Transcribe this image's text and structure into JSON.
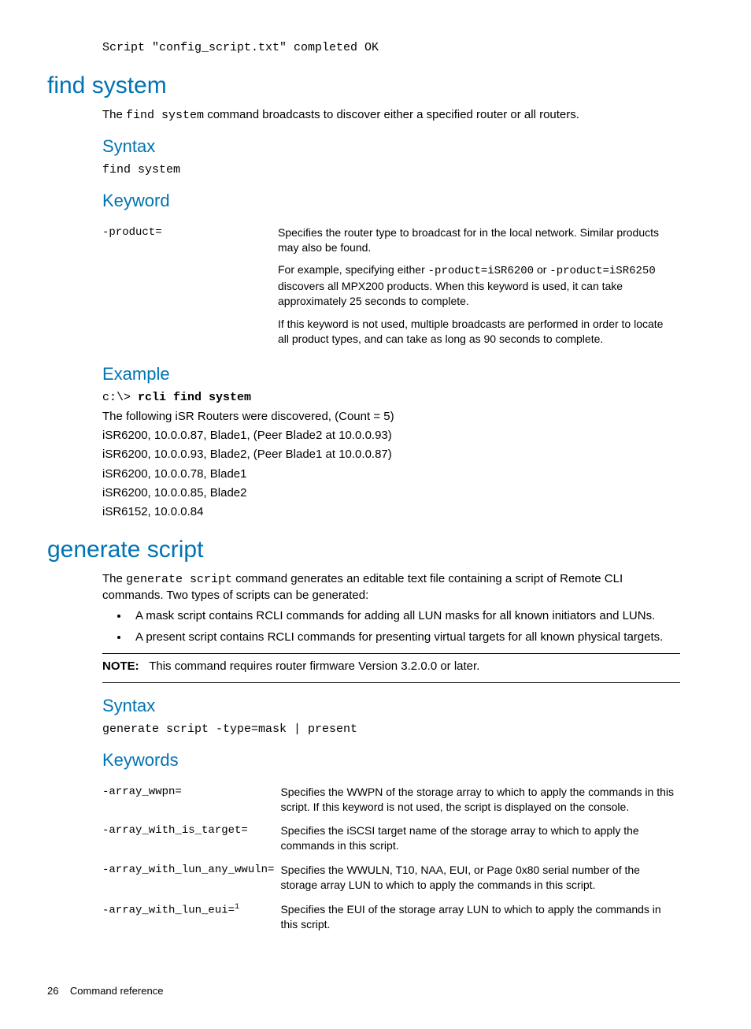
{
  "pre_code": "Script \"config_script.txt\" completed OK",
  "sections": {
    "find_system": {
      "title": "find system",
      "intro_pre": "The ",
      "intro_cmd": "find system",
      "intro_post": " command broadcasts to discover either a specified router or all routers.",
      "syntax": {
        "heading": "Syntax",
        "text": "find system"
      },
      "keyword": {
        "heading": "Keyword",
        "name": "-product=",
        "desc1": "Specifies the router type to broadcast for in the local network. Similar products may also be found.",
        "desc2_pre": "For example, specifying either ",
        "desc2_c1": "-product=iSR6200",
        "desc2_mid": " or ",
        "desc2_c2": "-product=iSR6250",
        "desc2_post": " discovers all MPX200 products. When this keyword is used, it can take approximately 25 seconds to complete.",
        "desc3": "If this keyword is not used, multiple broadcasts are performed in order to locate all product types, and can take as long as 90 seconds to complete."
      },
      "example": {
        "heading": "Example",
        "prompt": "c:\\> ",
        "cmd": "rcli find system",
        "lines": [
          "The following iSR Routers were discovered, (Count = 5)",
          "iSR6200, 10.0.0.87, Blade1, (Peer Blade2 at 10.0.0.93)",
          "iSR6200, 10.0.0.93, Blade2, (Peer Blade1 at 10.0.0.87)",
          "iSR6200, 10.0.0.78, Blade1",
          "iSR6200, 10.0.0.85, Blade2",
          "iSR6152, 10.0.0.84"
        ]
      }
    },
    "generate_script": {
      "title": "generate script",
      "intro_pre": "The ",
      "intro_cmd": "generate script",
      "intro_post": " command generates an editable text file containing a script of Remote CLI commands. Two types of scripts can be generated:",
      "bullets": [
        "A mask script contains RCLI commands for adding all LUN masks for all known initiators and LUNs.",
        "A present script contains RCLI commands for presenting virtual targets for all known physical targets."
      ],
      "note_label": "NOTE:",
      "note_text": "This command requires router firmware Version 3.2.0.0 or later.",
      "syntax": {
        "heading": "Syntax",
        "text": "generate script -type=mask | present"
      },
      "keywords": {
        "heading": "Keywords",
        "rows": [
          {
            "name": "-array_wwpn=",
            "desc": "Specifies the WWPN of the storage array to which to apply the commands in this script. If this keyword is not used, the script is displayed on the console."
          },
          {
            "name": "-array_with_is_target=",
            "desc": "Specifies the iSCSI target name of the storage array to which to apply the commands in this script."
          },
          {
            "name": "-array_with_lun_any_wwuln=",
            "desc": "Specifies the WWULN, T10, NAA, EUI, or Page 0x80 serial number of the storage array LUN to which to apply the commands in this script."
          },
          {
            "name": "-array_with_lun_eui=",
            "sup": "1",
            "desc": "Specifies the EUI of the storage array LUN to which to apply the commands in this script."
          }
        ]
      }
    }
  },
  "footer": {
    "page": "26",
    "label": "Command reference"
  }
}
